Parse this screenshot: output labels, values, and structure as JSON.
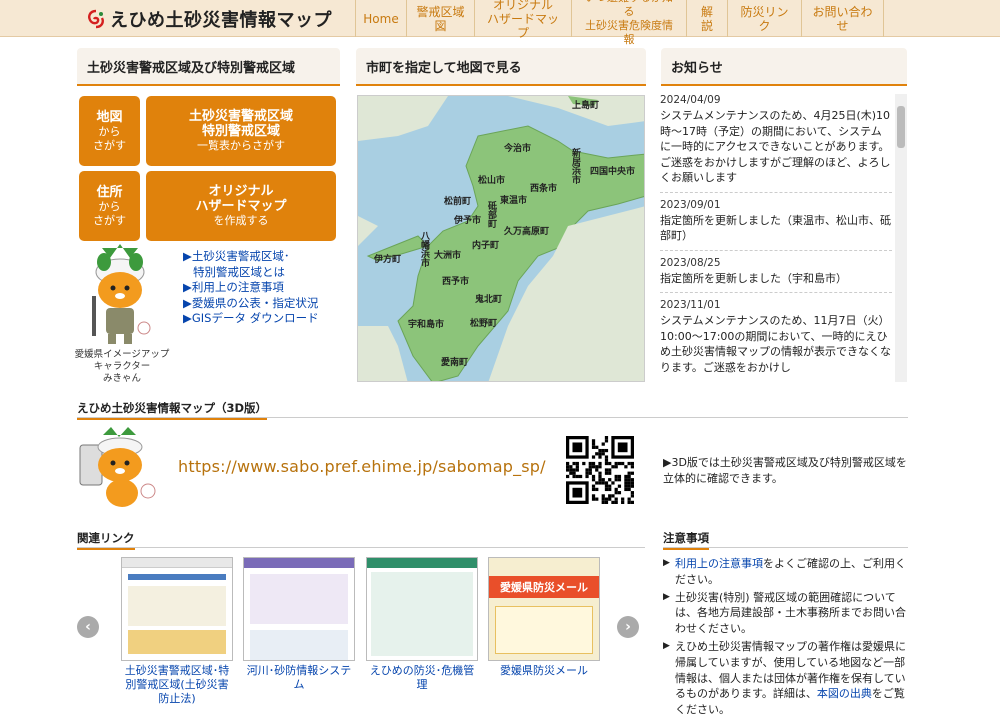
{
  "header": {
    "logo_text": "えひめ土砂災害情報マップ",
    "nav": [
      {
        "label": "Home"
      },
      {
        "label": "警戒区域図"
      },
      {
        "label": "オリジナル\nハザードマップ"
      },
      {
        "label": "いつ避難するか知る\n土砂災害危険度情報"
      },
      {
        "label": "解説"
      },
      {
        "label": "防災リンク"
      },
      {
        "label": "お問い合わせ"
      }
    ]
  },
  "search_panel": {
    "title": "土砂災害警戒区域及び特別警戒区域",
    "btn_map": {
      "l1": "地図",
      "l2": "から",
      "l3": "さがす"
    },
    "btn_list": {
      "l1": "土砂災害警戒区域",
      "l2": "特別警戒区域",
      "l3": "一覧表からさがす"
    },
    "btn_address": {
      "l1": "住所",
      "l2": "から",
      "l3": "さがす"
    },
    "btn_hazard": {
      "l1": "オリジナル",
      "l2": "ハザードマップ",
      "l3": "を作成する"
    },
    "links": [
      "▶土砂災害警戒区域･",
      "特別警戒区域とは",
      "▶利用上の注意事項",
      "▶愛媛県の公表・指定状況",
      "▶GISデータ ダウンロード"
    ],
    "mascot_caption": [
      "愛媛県イメージアップ",
      "キャラクター",
      "みきゃん"
    ]
  },
  "map_panel": {
    "title": "市町を指定して地図で見る",
    "labels": [
      "上島町",
      "今治市",
      "新居浜市",
      "四国中央市",
      "松山市",
      "西条市",
      "東温市",
      "松前町",
      "砥部町",
      "伊予市",
      "久万高原町",
      "内子町",
      "八幡浜市",
      "大洲市",
      "伊方町",
      "西予市",
      "鬼北町",
      "宇和島市",
      "松野町",
      "愛南町"
    ]
  },
  "news": {
    "title": "お知らせ",
    "items": [
      {
        "date": "2024/04/09",
        "body": "システムメンテナンスのため、4月25日(木)10時～17時（予定）の期間において、システムに一時的にアクセスできないことがあります。ご迷惑をおかけしますがご理解のほど、よろしくお願いします"
      },
      {
        "date": "2023/09/01",
        "body": "指定箇所を更新しました（東温市、松山市、砥部町）"
      },
      {
        "date": "2023/08/25",
        "body": "指定箇所を更新しました（宇和島市）"
      },
      {
        "date": "2023/11/01",
        "body": "システムメンテナンスのため、11月7日（火）10:00～17:00の期間において、一時的にえひめ土砂災害情報マップの情報が表示できなくなります。ご迷惑をおかけし"
      }
    ]
  },
  "map3d": {
    "title": "えひめ土砂災害情報マップ（3D版）",
    "url": "https://www.sabo.pref.ehime.jp/sabomap_sp/",
    "desc": "▶3D版では土砂災害警戒区域及び特別警戒区域を立体的に確認できます。"
  },
  "related": {
    "title": "関連リンク",
    "items": [
      {
        "caption": "土砂災害警戒区域･特別警戒区域(土砂災害防止法)"
      },
      {
        "caption": "河川･砂防情報システム"
      },
      {
        "caption": "えひめの防災･危機管理"
      },
      {
        "caption": "愛媛県防災メール"
      }
    ],
    "prev": "‹",
    "next": "›",
    "thumb4_title": "愛媛県防災メール"
  },
  "notes": {
    "title": "注意事項",
    "items": [
      {
        "link": "利用上の注意事項",
        "text": "をよくご確認の上、ご利用ください。"
      },
      {
        "link": "",
        "text": "土砂災害(特別) 警戒区域の範囲確認については、各地方局建設部・土木事務所までお問い合わせください。"
      },
      {
        "link": "",
        "text": "えひめ土砂災害情報マップの著作権は愛媛県に帰属していますが、使用している地図など一部情報は、個人または団体が著作権を保有しているものがあります。詳細は、",
        "link2": "本図の出典",
        "text2": "をご覧ください。"
      }
    ]
  },
  "colors": {
    "accent": "#e0820c",
    "header_bg": "#f6e8d3",
    "nav_text": "#c87a10",
    "land": "#8cc47a",
    "sea": "#a9cfe2"
  }
}
